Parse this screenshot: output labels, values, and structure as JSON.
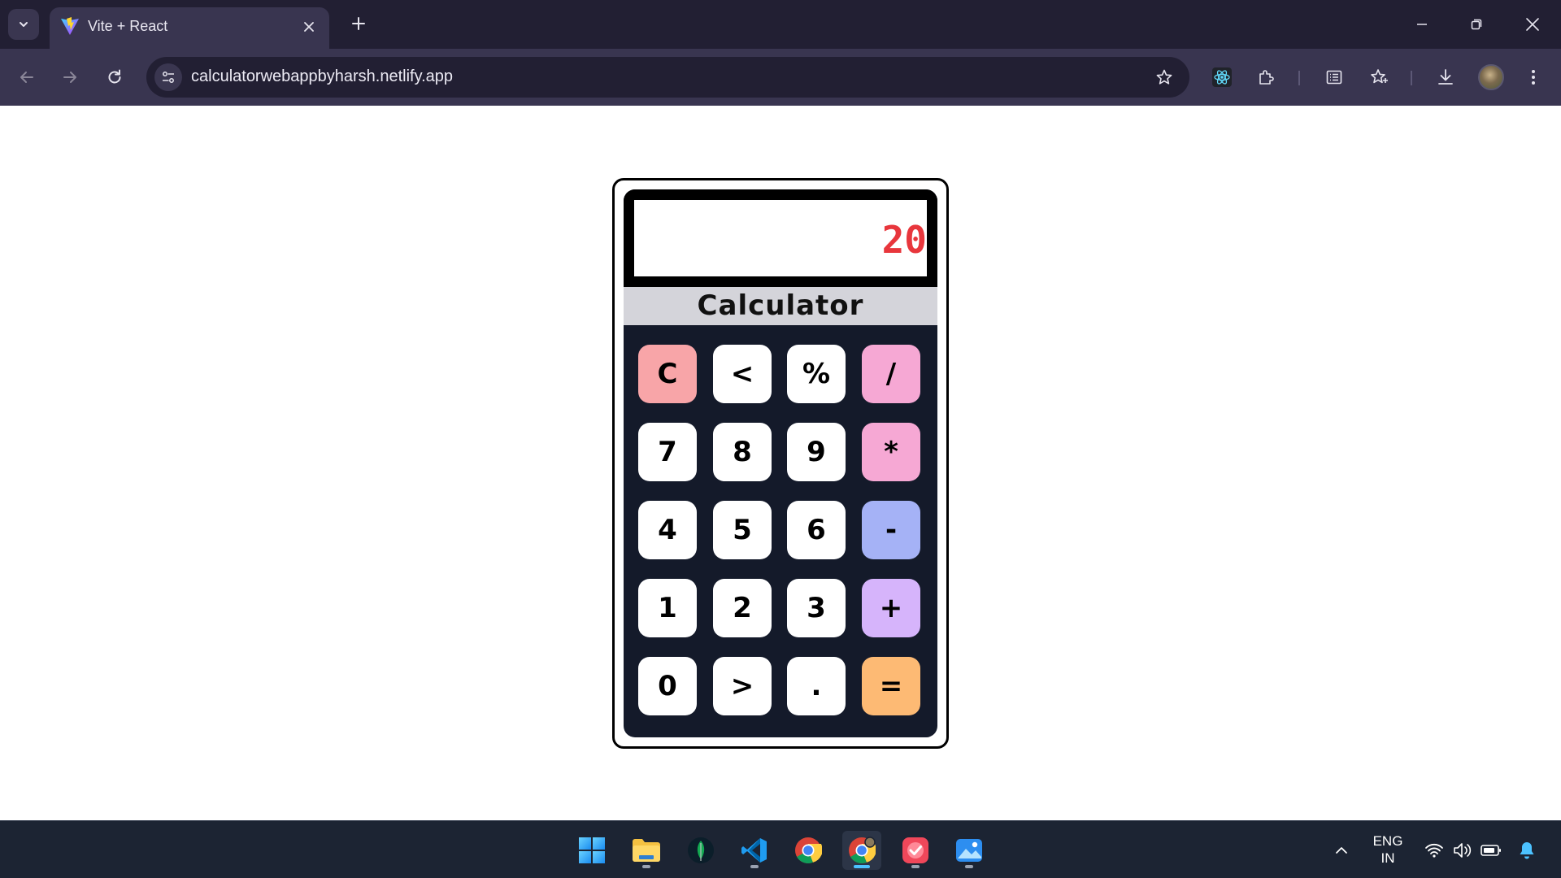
{
  "browser": {
    "tab_title": "Vite + React",
    "url": "calculatorwebappbyharsh.netlify.app"
  },
  "calculator": {
    "display_value": "20",
    "title": "Calculator",
    "keys": [
      [
        "C",
        "<",
        "%",
        "/"
      ],
      [
        "7",
        "8",
        "9",
        "*"
      ],
      [
        "4",
        "5",
        "6",
        "-"
      ],
      [
        "1",
        "2",
        "3",
        "+"
      ],
      [
        "0",
        ">",
        ".",
        "="
      ]
    ]
  },
  "taskbar": {
    "apps": [
      "windows-start",
      "file-explorer",
      "mongodb-compass",
      "vscode",
      "chrome",
      "chrome-profile",
      "todo-app",
      "photos"
    ],
    "lang_primary": "ENG",
    "lang_secondary": "IN"
  },
  "colors": {
    "display_text": "#e8363c",
    "clear_key": "#f8a5a8",
    "divide_multiply_keys": "#f6a8d4",
    "minus_key": "#a5b2f6",
    "plus_key": "#d6b4fb",
    "equals_key": "#fdba74",
    "keypad_bg": "#141a2a"
  }
}
